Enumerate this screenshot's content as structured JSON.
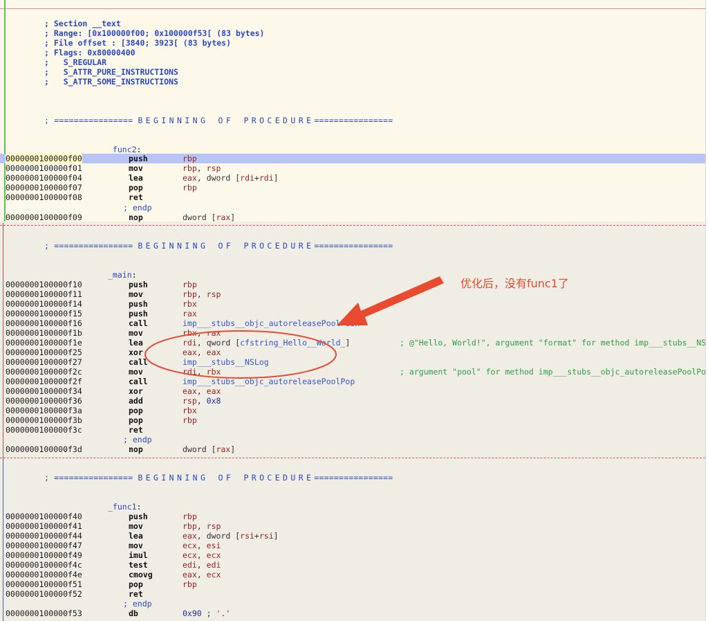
{
  "header": {
    "lines": [
      "; Section __text",
      "; Range: [0x100000f00; 0x100000f53[ (83 bytes)",
      "; File offset : [3840; 3923[ (83 bytes)",
      "; Flags: 0x80000400",
      ";   S_REGULAR",
      ";   S_ATTR_PURE_INSTRUCTIONS",
      ";   S_ATTR_SOME_INSTRUCTIONS"
    ]
  },
  "proc_banner": {
    "prefix": "; ================",
    "word1": "BEGINNING",
    "word2": "OF",
    "word3": "PROCEDURE",
    "suffix": "================"
  },
  "endp": "; endp",
  "func2": {
    "label": "_func2",
    "rows": [
      {
        "addr": "0000000100000f00",
        "mn": "push",
        "op": "rbp"
      },
      {
        "addr": "0000000100000f01",
        "mn": "mov",
        "op": "rbp, rsp"
      },
      {
        "addr": "0000000100000f04",
        "mn": "lea",
        "op": "eax, dword [rdi+rdi]"
      },
      {
        "addr": "0000000100000f07",
        "mn": "pop",
        "op": "rbp"
      },
      {
        "addr": "0000000100000f08",
        "mn": "ret",
        "op": ""
      }
    ],
    "trail": {
      "addr": "0000000100000f09",
      "mn": "nop",
      "op": "dword [rax]"
    }
  },
  "main": {
    "label": "_main",
    "rows": [
      {
        "addr": "0000000100000f10",
        "mn": "push",
        "op": "rbp"
      },
      {
        "addr": "0000000100000f11",
        "mn": "mov",
        "op": "rbp, rsp"
      },
      {
        "addr": "0000000100000f14",
        "mn": "push",
        "op": "rbx"
      },
      {
        "addr": "0000000100000f15",
        "mn": "push",
        "op": "rax"
      },
      {
        "addr": "0000000100000f16",
        "mn": "call",
        "op": "imp___stubs__objc_autoreleasePoolPush"
      },
      {
        "addr": "0000000100000f1b",
        "mn": "mov",
        "op": "rbx, rax"
      },
      {
        "addr": "0000000100000f1e",
        "mn": "lea",
        "op": "rdi, qword [cfstring_Hello__World_]",
        "comment": "; @\"Hello, World!\", argument \"format\" for method imp___stubs__NSLog"
      },
      {
        "addr": "0000000100000f25",
        "mn": "xor",
        "op": "eax, eax"
      },
      {
        "addr": "0000000100000f27",
        "mn": "call",
        "op": "imp___stubs__NSLog"
      },
      {
        "addr": "0000000100000f2c",
        "mn": "mov",
        "op": "rdi, rbx",
        "comment": "; argument \"pool\" for method imp___stubs__objc_autoreleasePoolPop"
      },
      {
        "addr": "0000000100000f2f",
        "mn": "call",
        "op": "imp___stubs__objc_autoreleasePoolPop"
      },
      {
        "addr": "0000000100000f34",
        "mn": "xor",
        "op": "eax, eax"
      },
      {
        "addr": "0000000100000f36",
        "mn": "add",
        "op": "rsp, 0x8"
      },
      {
        "addr": "0000000100000f3a",
        "mn": "pop",
        "op": "rbx"
      },
      {
        "addr": "0000000100000f3b",
        "mn": "pop",
        "op": "rbp"
      },
      {
        "addr": "0000000100000f3c",
        "mn": "ret",
        "op": ""
      }
    ],
    "trail": {
      "addr": "0000000100000f3d",
      "mn": "nop",
      "op": "dword [rax]"
    }
  },
  "func1": {
    "label": "_func1",
    "rows": [
      {
        "addr": "0000000100000f40",
        "mn": "push",
        "op": "rbp"
      },
      {
        "addr": "0000000100000f41",
        "mn": "mov",
        "op": "rbp, rsp"
      },
      {
        "addr": "0000000100000f44",
        "mn": "lea",
        "op": "eax, dword [rsi+rsi]"
      },
      {
        "addr": "0000000100000f47",
        "mn": "mov",
        "op": "ecx, esi"
      },
      {
        "addr": "0000000100000f49",
        "mn": "imul",
        "op": "ecx, ecx"
      },
      {
        "addr": "0000000100000f4c",
        "mn": "test",
        "op": "edi, edi"
      },
      {
        "addr": "0000000100000f4e",
        "mn": "cmovg",
        "op": "eax, ecx"
      },
      {
        "addr": "0000000100000f51",
        "mn": "pop",
        "op": "rbp"
      },
      {
        "addr": "0000000100000f52",
        "mn": "ret",
        "op": ""
      }
    ],
    "trail": {
      "addr": "0000000100000f53",
      "mn": "db",
      "op": "0x90 ; '.'"
    }
  },
  "annotation": {
    "text": "优化后，没有func1了",
    "color": "#e94a30"
  },
  "colors": {
    "selection": "#b7c4f5",
    "register": "#9b1f1f",
    "symbol": "#3658c8",
    "comment": "#2e9f45"
  }
}
